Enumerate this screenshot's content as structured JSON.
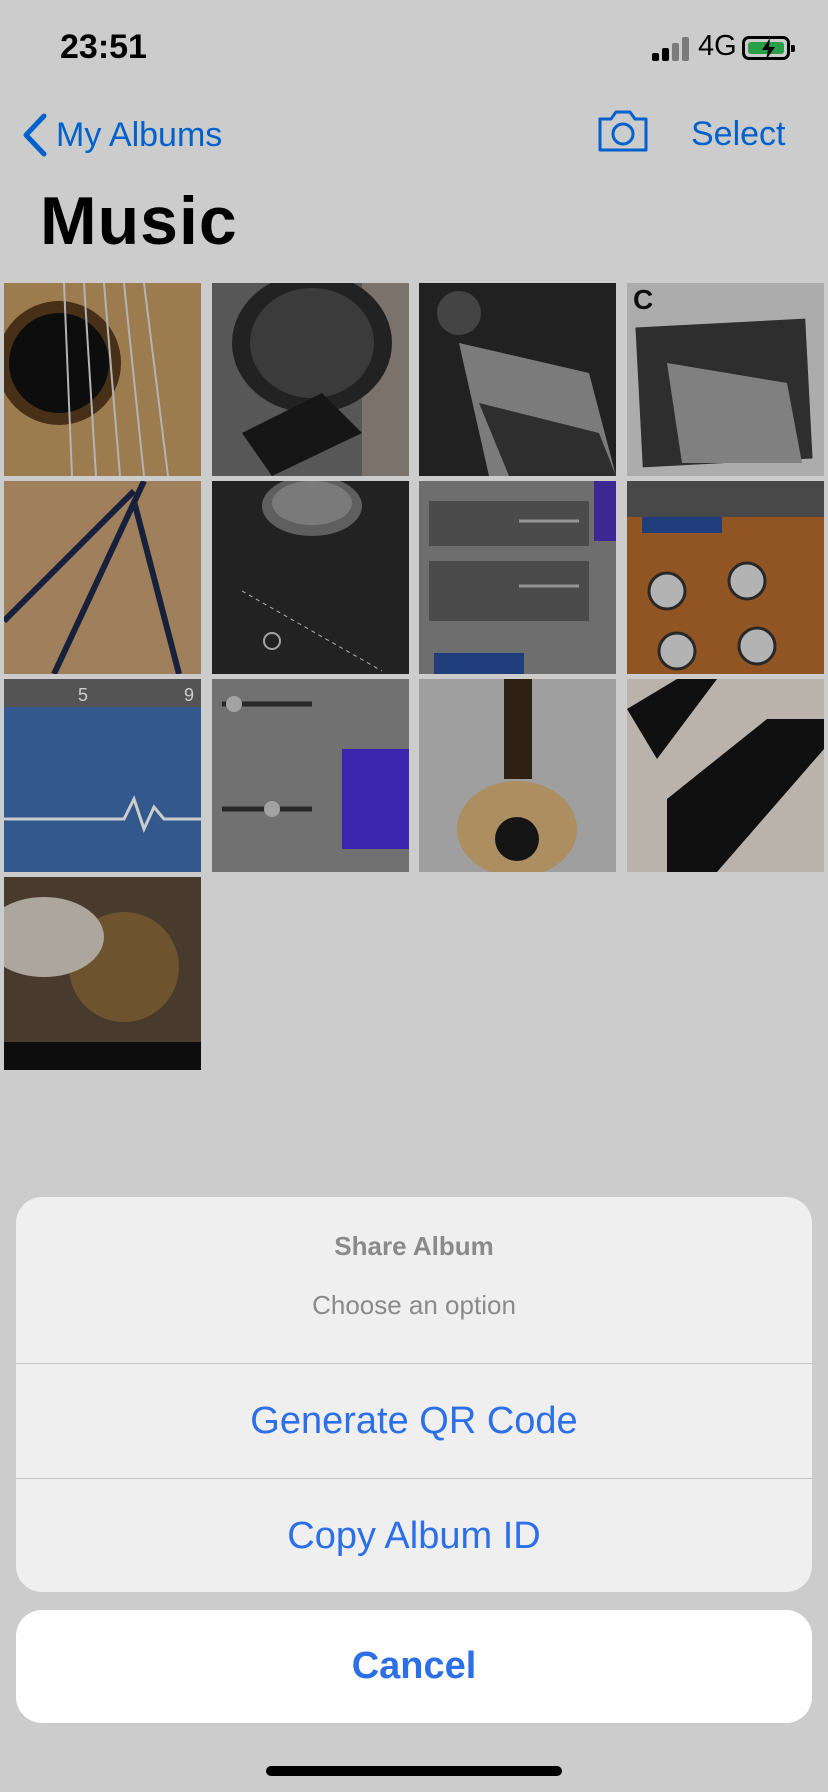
{
  "status_bar": {
    "time": "23:51",
    "network": "4G"
  },
  "nav": {
    "back_label": "My Albums",
    "select_label": "Select"
  },
  "album": {
    "title": "Music",
    "photos": [
      {
        "icon": "acoustic-guitar-soundhole-photo"
      },
      {
        "icon": "microphone-photo"
      },
      {
        "icon": "guitar-pedal-photo"
      },
      {
        "icon": "guitar-pedal-album-art-photo"
      },
      {
        "icon": "guitar-picks-photo"
      },
      {
        "icon": "audio-interface-knob-photo"
      },
      {
        "icon": "garageband-track-controls-photo"
      },
      {
        "icon": "drum-mix-controls-photo"
      },
      {
        "icon": "audio-waveform-timeline-photo"
      },
      {
        "icon": "mixer-sliders-waveform-photo"
      },
      {
        "icon": "acoustic-guitar-photo"
      },
      {
        "icon": "piano-keys-photo"
      },
      {
        "icon": "wicker-balls-photo"
      }
    ]
  },
  "action_sheet": {
    "title": "Share Album",
    "message": "Choose an option",
    "actions": [
      {
        "label": "Generate QR Code"
      },
      {
        "label": "Copy Album ID"
      }
    ],
    "cancel_label": "Cancel"
  },
  "colors": {
    "accent": "#2c6fe6",
    "sheet_bg": "#efefef",
    "battery_green": "#34c759"
  }
}
